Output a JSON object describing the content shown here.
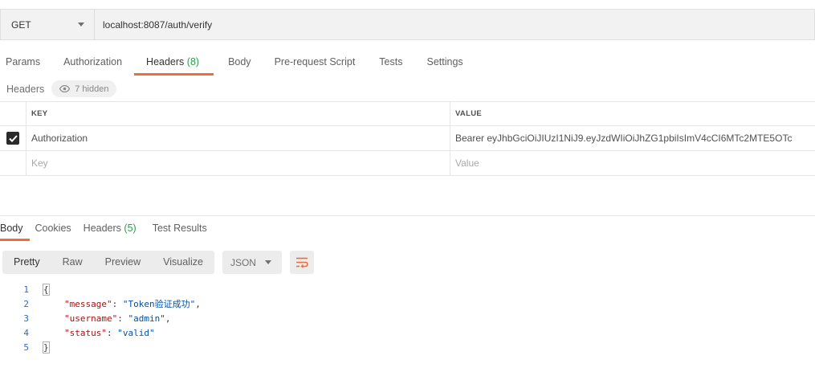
{
  "request": {
    "method": "GET",
    "url": "localhost:8087/auth/verify"
  },
  "req_tabs": [
    {
      "label": "Params"
    },
    {
      "label": "Authorization"
    },
    {
      "label": "Headers",
      "count": "(8)"
    },
    {
      "label": "Body"
    },
    {
      "label": "Pre-request Script"
    },
    {
      "label": "Tests"
    },
    {
      "label": "Settings"
    }
  ],
  "headers_section": {
    "label": "Headers",
    "hidden": "7 hidden",
    "columns": {
      "key": "KEY",
      "value": "VALUE"
    },
    "rows": [
      {
        "checked": true,
        "key": "Authorization",
        "value": "Bearer eyJhbGciOiJIUzI1NiJ9.eyJzdWIiOiJhZG1pbiIsImV4cCI6MTc2MTE5OTc"
      }
    ],
    "placeholder": {
      "key": "Key",
      "value": "Value"
    }
  },
  "res_tabs": [
    {
      "label": "Body"
    },
    {
      "label": "Cookies"
    },
    {
      "label": "Headers",
      "count": "(5)"
    },
    {
      "label": "Test Results"
    }
  ],
  "res_toolbar": {
    "formats": [
      "Pretty",
      "Raw",
      "Preview",
      "Visualize"
    ],
    "language": "JSON"
  },
  "code_lines": [
    {
      "n": "1",
      "open": "{"
    },
    {
      "n": "2",
      "key": "\"message\"",
      "val": "\"Token验证成功\"",
      "comma": ","
    },
    {
      "n": "3",
      "key": "\"username\"",
      "val": "\"admin\"",
      "comma": ","
    },
    {
      "n": "4",
      "key": "\"status\"",
      "val": "\"valid\"",
      "comma": ""
    },
    {
      "n": "5",
      "open": "}"
    }
  ],
  "colors": {
    "accent": "#f26b3a",
    "count": "#2d9c4e",
    "line_number": "#2a6cc4",
    "json_key": "#a31515",
    "json_string": "#0451a5"
  }
}
